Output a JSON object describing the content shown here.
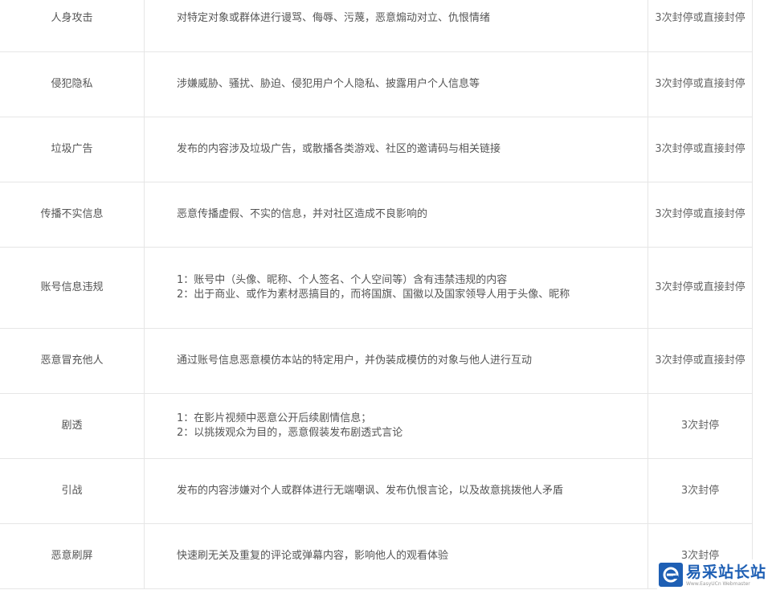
{
  "rules": [
    {
      "name": "人身攻击",
      "desc": [
        "对特定对象或群体进行谩骂、侮辱、污蔑，恶意煽动对立、仇恨情绪"
      ],
      "penalty": "3次封停或直接封停"
    },
    {
      "name": "侵犯隐私",
      "desc": [
        "涉嫌威胁、骚扰、胁迫、侵犯用户个人隐私、披露用户个人信息等"
      ],
      "penalty": "3次封停或直接封停"
    },
    {
      "name": "垃圾广告",
      "desc": [
        "发布的内容涉及垃圾广告，或散播各类游戏、社区的邀请码与相关链接"
      ],
      "penalty": "3次封停或直接封停"
    },
    {
      "name": "传播不实信息",
      "desc": [
        "恶意传播虚假、不实的信息，并对社区造成不良影响的"
      ],
      "penalty": "3次封停或直接封停"
    },
    {
      "name": "账号信息违规",
      "desc": [
        "1：账号中（头像、昵称、个人签名、个人空间等）含有违禁违规的内容",
        "2：出于商业、或作为素材恶搞目的，而将国旗、国徽以及国家领导人用于头像、昵称"
      ],
      "penalty": "3次封停或直接封停"
    },
    {
      "name": "恶意冒充他人",
      "desc": [
        "通过账号信息恶意模仿本站的特定用户，并伪装成模仿的对象与他人进行互动"
      ],
      "penalty": "3次封停或直接封停"
    },
    {
      "name": "剧透",
      "desc": [
        "1：在影片视频中恶意公开后续剧情信息；",
        "2：以挑拨观众为目的，恶意假装发布剧透式言论"
      ],
      "penalty": "3次封停"
    },
    {
      "name": "引战",
      "desc": [
        "发布的内容涉嫌对个人或群体进行无端嘲讽、发布仇恨言论，以及故意挑拨他人矛盾"
      ],
      "penalty": "3次封停"
    },
    {
      "name": "恶意刷屏",
      "desc": [
        "快速刷无关及重复的评论或弹幕内容，影响他人的观看体验"
      ],
      "penalty": "3次封停"
    }
  ],
  "watermark": {
    "text": "易采站长站",
    "subtext": "Www.EasyUCn Webmaster",
    "icon": "e-logo-icon",
    "color": "#1e5fb4"
  }
}
